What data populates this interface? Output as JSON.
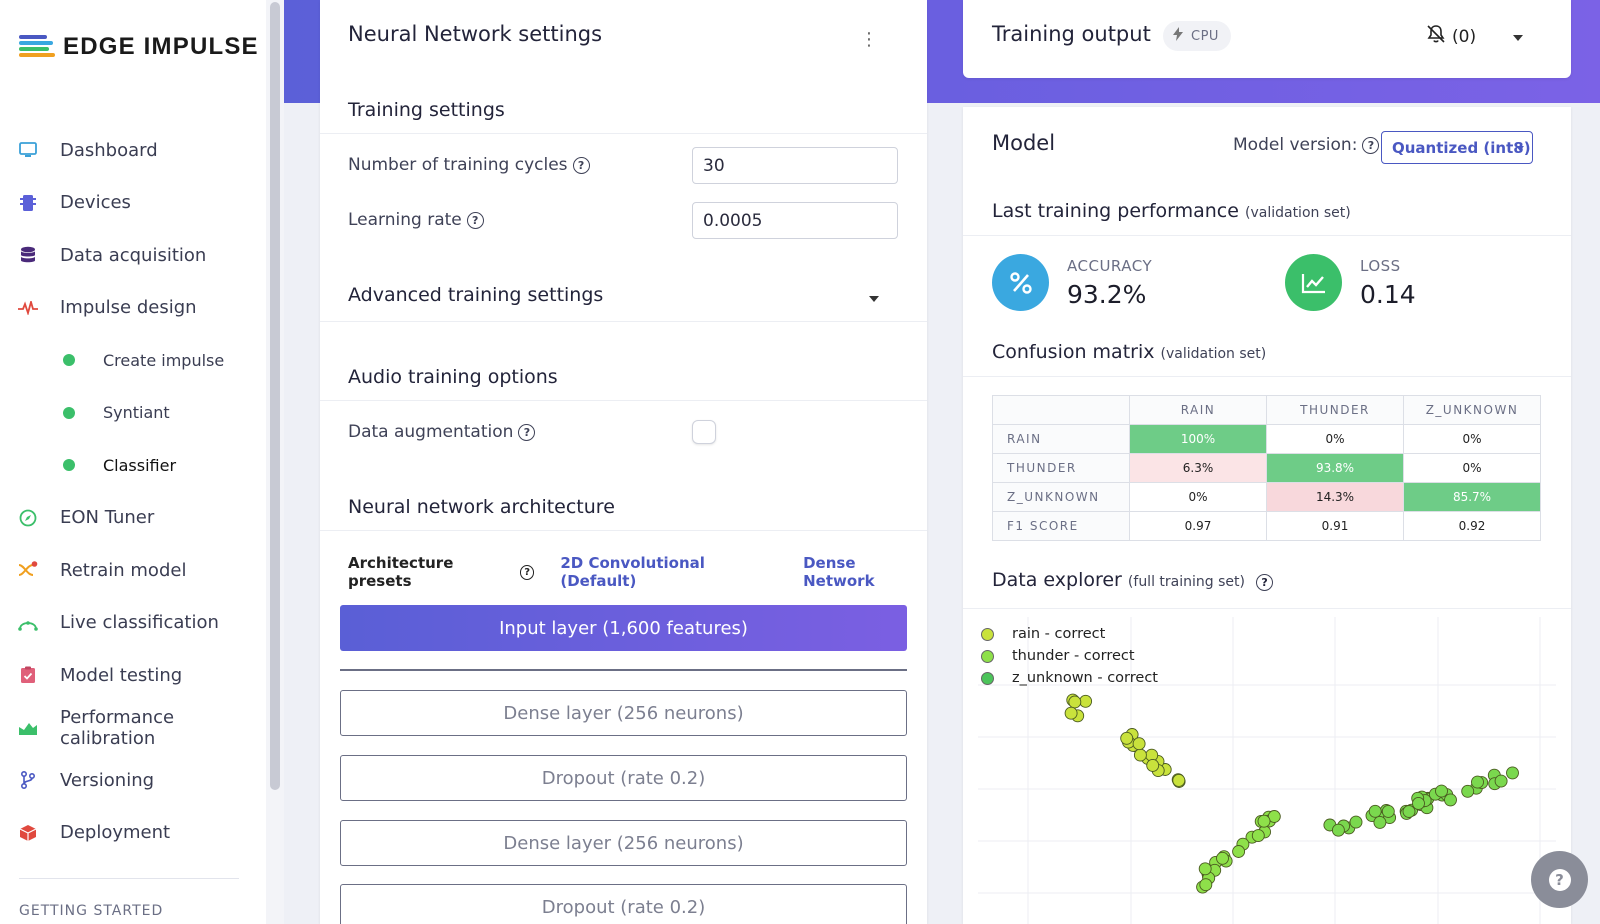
{
  "app": {
    "logo_text": "EDGE IMPULSE"
  },
  "sidebar": {
    "items": [
      {
        "label": "Dashboard",
        "icon": "monitor-icon",
        "color": "#3aa0d8"
      },
      {
        "label": "Devices",
        "icon": "chip-icon",
        "color": "#5b60d8"
      },
      {
        "label": "Data acquisition",
        "icon": "database-icon",
        "color": "#4a2a7a"
      },
      {
        "label": "Impulse design",
        "icon": "pulse-icon",
        "color": "#e0493e"
      }
    ],
    "sub_items": [
      {
        "label": "Create impulse"
      },
      {
        "label": "Syntiant"
      },
      {
        "label": "Classifier"
      }
    ],
    "items2": [
      {
        "label": "EON Tuner",
        "icon": "compass-icon",
        "color": "#3bbf6a"
      },
      {
        "label": "Retrain model",
        "icon": "shuffle-icon",
        "color": "#f0a020"
      },
      {
        "label": "Live classification",
        "icon": "signal-icon",
        "color": "#3bbf6a"
      },
      {
        "label": "Model testing",
        "icon": "clipboard-check-icon",
        "color": "#e0607a"
      },
      {
        "label": "Performance calibration",
        "icon": "area-chart-icon",
        "color": "#3bbf6a"
      },
      {
        "label": "Versioning",
        "icon": "branch-icon",
        "color": "#4a58c2"
      },
      {
        "label": "Deployment",
        "icon": "box-icon",
        "color": "#e0493e"
      }
    ],
    "section_label": "GETTING STARTED"
  },
  "nn": {
    "title": "Neural Network settings",
    "training_settings": "Training settings",
    "cycles_label": "Number of training cycles",
    "cycles_value": "30",
    "lr_label": "Learning rate",
    "lr_value": "0.0005",
    "advanced": "Advanced training settings",
    "audio_options": "Audio training options",
    "augmentation_label": "Data augmentation",
    "augmentation_on": false,
    "arch_heading": "Neural network architecture",
    "presets_label": "Architecture presets",
    "preset_1": "2D Convolutional (Default)",
    "preset_2": "Dense Network",
    "input_layer": "Input layer (1,600 features)",
    "layers": [
      "Dense layer (256 neurons)",
      "Dropout (rate 0.2)",
      "Dense layer (256 neurons)",
      "Dropout (rate 0.2)"
    ]
  },
  "output": {
    "title": "Training output",
    "device_badge": "CPU",
    "notifications": "(0)"
  },
  "model": {
    "title": "Model",
    "version_label": "Model version:",
    "version_value": "Quantized (int8)",
    "perf_heading": "Last training performance",
    "perf_sub": "(validation set)",
    "accuracy_label": "ACCURACY",
    "accuracy_value": "93.2%",
    "loss_label": "LOSS",
    "loss_value": "0.14",
    "cm_heading": "Confusion matrix",
    "cm_sub": "(validation set)",
    "cm_headers": [
      "RAIN",
      "THUNDER",
      "Z_UNKNOWN"
    ],
    "cm_rows": [
      {
        "label": "RAIN",
        "cells": [
          "100%",
          "0%",
          "0%"
        ]
      },
      {
        "label": "THUNDER",
        "cells": [
          "6.3%",
          "93.8%",
          "0%"
        ]
      },
      {
        "label": "Z_UNKNOWN",
        "cells": [
          "0%",
          "14.3%",
          "85.7%"
        ]
      },
      {
        "label": "F1 SCORE",
        "cells": [
          "0.97",
          "0.91",
          "0.92"
        ]
      }
    ],
    "explorer_heading": "Data explorer",
    "explorer_sub": "(full training set)",
    "legend": [
      {
        "label": "rain - correct",
        "color": "#c9e23c"
      },
      {
        "label": "thunder - correct",
        "color": "#8ee04a"
      },
      {
        "label": "z_unknown - correct",
        "color": "#4cc45a"
      }
    ]
  },
  "colors": {
    "accent": "#4a58c2",
    "success": "#3bbf6a",
    "accuracy_circle": "#3aa8e0",
    "loss_circle": "#3bbf6a"
  }
}
